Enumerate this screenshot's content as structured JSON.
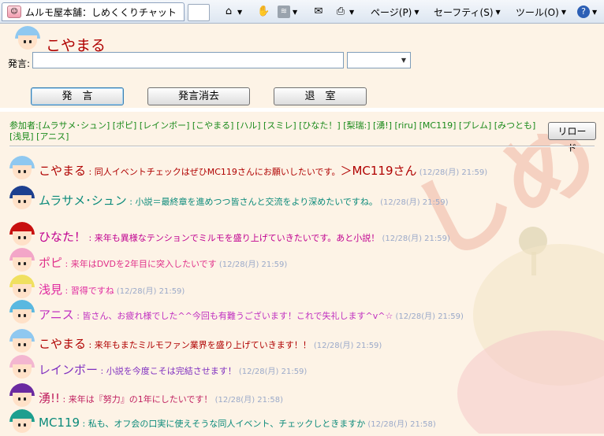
{
  "browser": {
    "tab_title": "ムルモ屋本舗：しめくくりチャット",
    "menu": [
      "ページ(P)",
      "セーフティ(S)",
      "ツール(O)"
    ],
    "icons": [
      "home-icon",
      "rss-icon",
      "mail-icon",
      "print-icon",
      "help-icon"
    ]
  },
  "chat": {
    "user_name": "こやまる",
    "say_label": "発言:",
    "buttons": {
      "say": "発　言",
      "clear": "発言消去",
      "exit": "退　室",
      "reload": "リロード"
    },
    "participants_text": "参加者:[ムラサメ･シュン] [ポピ] [レインボー] [こやまる] [ハル] [スミレ] [ひなた！] [梨瑞:] [湧!] [riru] [MC119] [プレム] [みつとも] [浅見] [アニス]",
    "messages": [
      {
        "name": "こやまる",
        "text": "同人イベントチェックはぜひMC119さんにお願いしたいです。",
        "extra": "＞MC119さん",
        "time": "(12/28(月) 21:59)",
        "color": "#b00000"
      },
      {
        "name": "ムラサメ･シュン",
        "text": "小説＝最終章を進めつつ皆さんと交流をより深めたいですね。",
        "extra": "",
        "time": "(12/28(月) 21:59)",
        "color": "#0a8a7a"
      },
      {
        "name": "ひなた！",
        "text": "来年も異様なテンションでミルモを盛り上げていきたいです。あと小説！",
        "extra": "",
        "time": "(12/28(月) 21:59)",
        "color": "#c00090"
      },
      {
        "name": "ポピ",
        "text": "来年はDVDを2年目に突入したいです",
        "extra": "",
        "time": "(12/28(月) 21:59)",
        "color": "#e0308a"
      },
      {
        "name": "浅見",
        "text": "習得ですね",
        "extra": "",
        "time": "(12/28(月) 21:59)",
        "color": "#e02aa0"
      },
      {
        "name": "アニス",
        "text": "皆さん、お疲れ様でした^^今回も有難うございます！これで失礼します^v^☆",
        "extra": "",
        "time": "(12/28(月) 21:59)",
        "color": "#c030c0"
      },
      {
        "name": "こやまる",
        "text": "来年もまたミルモファン業界を盛り上げていきます！！",
        "extra": "",
        "time": "(12/28(月) 21:59)",
        "color": "#b00000"
      },
      {
        "name": "レインボー",
        "text": "小説を今度こそは完結させます！",
        "extra": "",
        "time": "(12/28(月) 21:59)",
        "color": "#8030c0"
      },
      {
        "name": "湧!!",
        "text": "来年は『努力』の1年にしたいです！",
        "extra": "",
        "time": "(12/28(月) 21:58)",
        "color": "#c02060"
      },
      {
        "name": "MC119",
        "text": "私も、オフ会の口実に使えそうな同人イベント、チェックしときますか",
        "extra": "",
        "time": "(12/28(月) 21:58)",
        "color": "#0a8a7a"
      }
    ]
  },
  "colors": {
    "background": "#fdf3e6",
    "participants": "#1a8a1a",
    "time": "#9aa9c9"
  }
}
